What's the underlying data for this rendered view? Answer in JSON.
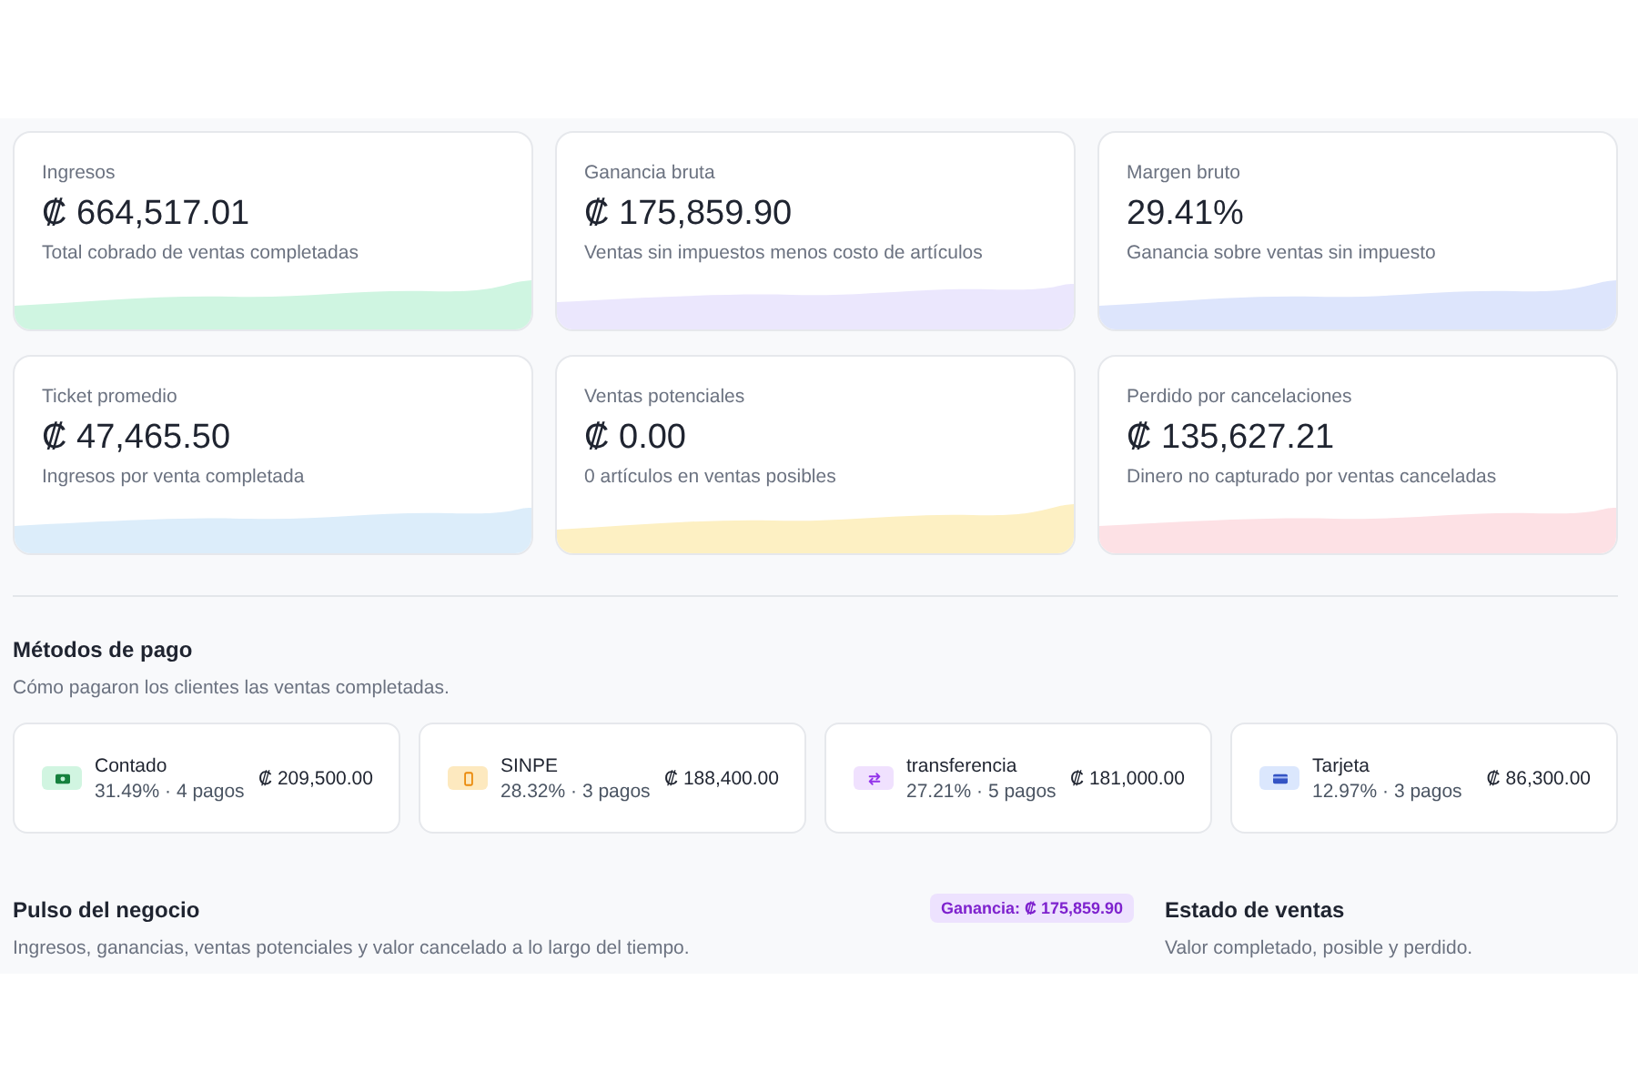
{
  "kpis": [
    {
      "label": "Ingresos",
      "value": "₡ 664,517.01",
      "caption": "Total cobrado de ventas completadas",
      "color": "#cff5e1"
    },
    {
      "label": "Ganancia bruta",
      "value": "₡ 175,859.90",
      "caption": "Ventas sin impuestos menos costo de artículos",
      "color": "#ebe7fd"
    },
    {
      "label": "Margen bruto",
      "value": "29.41%",
      "caption": "Ganancia sobre ventas sin impuesto",
      "color": "#dde5fc"
    },
    {
      "label": "Ticket promedio",
      "value": "₡ 47,465.50",
      "caption": "Ingresos por venta completada",
      "color": "#dcedfa"
    },
    {
      "label": "Ventas potenciales",
      "value": "₡ 0.00",
      "caption": "0 artículos en ventas posibles",
      "color": "#fdf0c3"
    },
    {
      "label": "Perdido por cancelaciones",
      "value": "₡ 135,627.21",
      "caption": "Dinero no capturado por ventas canceladas",
      "color": "#fde1e5"
    }
  ],
  "payment_methods": {
    "title": "Métodos de pago",
    "subtitle": "Cómo pagaron los clientes las ventas completadas.",
    "items": [
      {
        "kind": "cash",
        "name": "Contado",
        "detail": "31.49% · 4 pagos",
        "amount": "₡ 209,500.00",
        "color": "#d1f5e1"
      },
      {
        "kind": "phone",
        "name": "SINPE",
        "detail": "28.32% · 3 pagos",
        "amount": "₡ 188,400.00",
        "color": "#fde9bf"
      },
      {
        "kind": "transfer",
        "name": "transferencia",
        "detail": "27.21% · 5 pagos",
        "amount": "₡ 181,000.00",
        "color": "#f0e1fe"
      },
      {
        "kind": "card",
        "name": "Tarjeta",
        "detail": "12.97% · 3 pagos",
        "amount": "₡ 86,300.00",
        "color": "#dbe7fd"
      }
    ]
  },
  "business_pulse": {
    "title": "Pulso del negocio",
    "subtitle": "Ingresos, ganancias, ventas potenciales y valor cancelado a lo largo del tiempo.",
    "badge": "Ganancia: ₡ 175,859.90"
  },
  "sales_status": {
    "title": "Estado de ventas",
    "subtitle": "Valor completado, posible y perdido."
  }
}
